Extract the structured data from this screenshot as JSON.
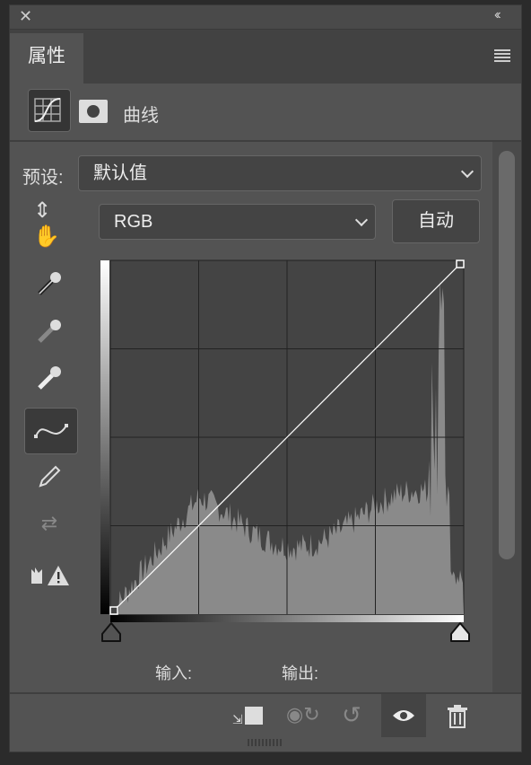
{
  "window": {
    "close_icon": "close-icon",
    "collapse_icon": "double-chevron-left-icon"
  },
  "tab": {
    "label": "属性",
    "menu_icon": "hamburger-menu-icon"
  },
  "adjustment": {
    "name": "曲线",
    "curves_icon": "curves-icon",
    "mask_icon": "mask-icon"
  },
  "preset": {
    "label": "预设:",
    "value": "默认值"
  },
  "channel": {
    "value": "RGB"
  },
  "auto_button": "自动",
  "tools": [
    "on-image-adjust-icon",
    "black-point-eyedropper-icon",
    "gray-point-eyedropper-icon",
    "white-point-eyedropper-icon",
    "curve-points-icon",
    "pencil-icon",
    "smooth-icon",
    "clipping-warning-icon"
  ],
  "curve": {
    "points": [
      [
        0,
        0
      ],
      [
        255,
        255
      ]
    ]
  },
  "io": {
    "input_label": "输入:",
    "output_label": "输出:"
  },
  "footer": [
    "clip-to-layer-icon",
    "view-previous-state-icon",
    "reset-icon",
    "visibility-eye-icon",
    "trash-icon"
  ]
}
